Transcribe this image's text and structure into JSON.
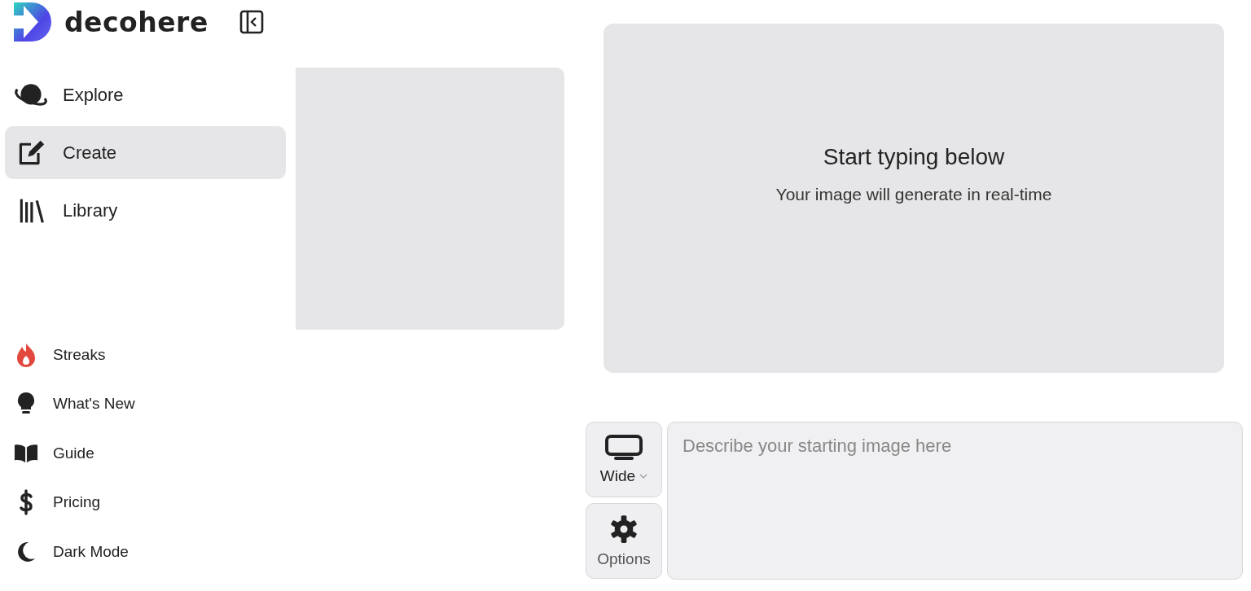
{
  "brand": {
    "name": "decohere"
  },
  "nav": [
    {
      "label": "Explore",
      "selected": false
    },
    {
      "label": "Create",
      "selected": true
    },
    {
      "label": "Library",
      "selected": false
    }
  ],
  "links": [
    {
      "label": "Streaks"
    },
    {
      "label": "What's New"
    },
    {
      "label": "Guide"
    },
    {
      "label": "Pricing"
    },
    {
      "label": "Dark Mode"
    }
  ],
  "preview": {
    "title": "Start typing below",
    "subtitle": "Your image will generate in real-time"
  },
  "composer": {
    "aspect": "Wide",
    "options": "Options",
    "prompt": {
      "placeholder": "Describe your starting image here"
    }
  }
}
